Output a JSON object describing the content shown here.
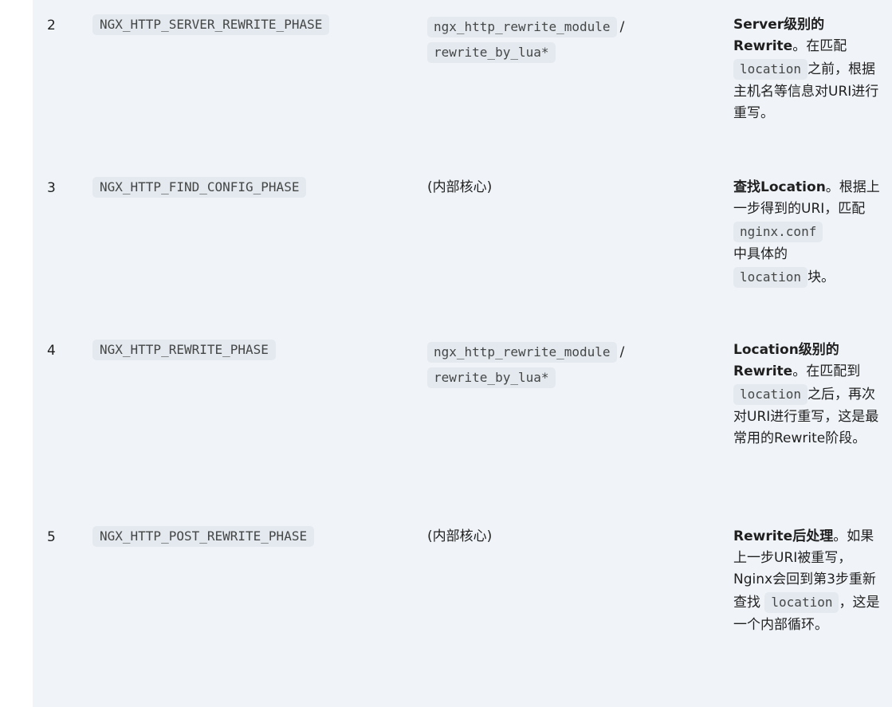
{
  "rows": [
    {
      "number": "2",
      "phase": "NGX_HTTP_SERVER_REWRITE_PHASE",
      "module_code_a": "ngx_http_rewrite_module",
      "module_sep": "/",
      "module_code_b": "rewrite_by_lua*",
      "desc": {
        "bold": "Server级别的Rewrite",
        "t1": "。在匹配",
        "code1": "location",
        "t2": "之前，根据主机名等信息对URI进行重写。"
      }
    },
    {
      "number": "3",
      "phase": "NGX_HTTP_FIND_CONFIG_PHASE",
      "module_text": "(内部核心)",
      "desc": {
        "bold": "查找Location",
        "t1": "。根据上一步得到的URI，匹配",
        "code1": "nginx.conf",
        "t2": "中具体的",
        "code2": "location",
        "t3": "块。"
      }
    },
    {
      "number": "4",
      "phase": "NGX_HTTP_REWRITE_PHASE",
      "module_code_a": "ngx_http_rewrite_module",
      "module_sep": "/",
      "module_code_b": "rewrite_by_lua*",
      "desc": {
        "bold": "Location级别的Rewrite",
        "t1": "。在匹配到",
        "code1": "location",
        "t2": "之后，再次对URI进行重写，这是最常用的Rewrite阶段。"
      }
    },
    {
      "number": "5",
      "phase": "NGX_HTTP_POST_REWRITE_PHASE",
      "module_text": "(内部核心)",
      "desc": {
        "bold": "Rewrite后处理",
        "t1": "。如果上一步URI被重写，Nginx会回到第3步重新查找",
        "code1": "location",
        "t2": "，这是一个内部循环。"
      }
    }
  ]
}
